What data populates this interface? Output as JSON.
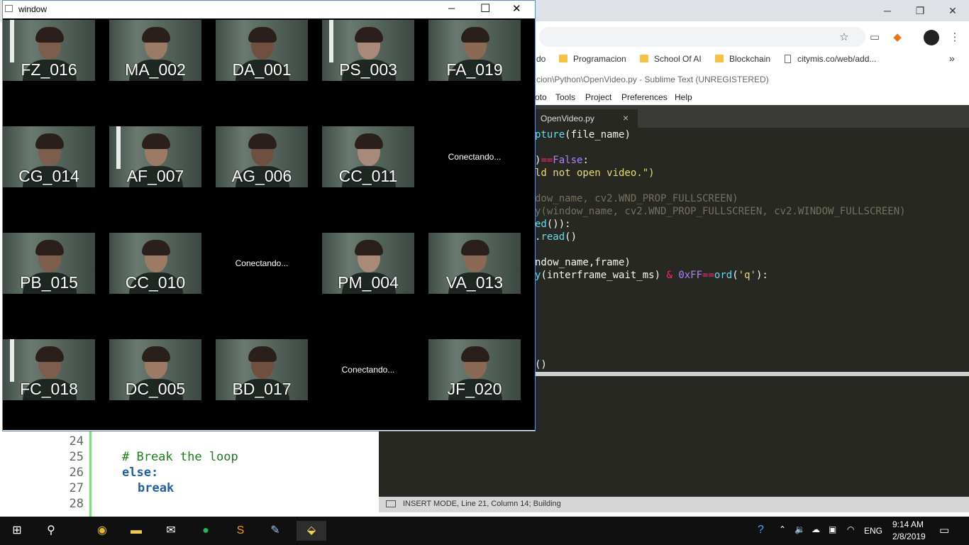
{
  "chrome": {
    "bookmarks": [
      {
        "label": "do",
        "type": "text"
      },
      {
        "label": "Programacion",
        "type": "folder"
      },
      {
        "label": "School Of AI",
        "type": "folder"
      },
      {
        "label": "Blockchain",
        "type": "folder"
      },
      {
        "label": "citymis.co/web/add...",
        "type": "page"
      }
    ],
    "more": "»",
    "controls": {
      "minimize": "─",
      "restore": "❐",
      "close": "✕"
    }
  },
  "sublime": {
    "title": "cion\\Python\\OpenVideo.py - Sublime Text (UNREGISTERED)",
    "menu": [
      "oto",
      "Tools",
      "Project",
      "Preferences",
      "Help"
    ],
    "tab": {
      "label": "OpenVideo.py",
      "close": "×"
    },
    "status": "INSERT MODE, Line 21, Column 14; Building"
  },
  "code_bg": {
    "lines": [
      {
        "num": "24",
        "text": ""
      },
      {
        "num": "25",
        "text": "# Break the loop"
      },
      {
        "num": "26",
        "text": "else:"
      },
      {
        "num": "27",
        "text": "break"
      },
      {
        "num": "28",
        "text": ""
      }
    ]
  },
  "video_window": {
    "title": "window",
    "controls": {
      "minimize": "─",
      "maximize": "☐",
      "close": "✕"
    },
    "cells": [
      {
        "label": "FZ_016"
      },
      {
        "label": "MA_002"
      },
      {
        "label": "DA_001"
      },
      {
        "label": "PS_003"
      },
      {
        "label": "FA_019"
      },
      {
        "label": "CG_014"
      },
      {
        "label": "AF_007"
      },
      {
        "label": "AG_006"
      },
      {
        "label": "CC_011"
      },
      {
        "status": "Conectando..."
      },
      {
        "label": "PB_015"
      },
      {
        "label": "CC_010"
      },
      {
        "status": "Conectando..."
      },
      {
        "label": "PM_004"
      },
      {
        "label": "VA_013"
      },
      {
        "label": "FC_018"
      },
      {
        "label": "DC_005"
      },
      {
        "label": "BD_017"
      },
      {
        "status": "Conectando..."
      },
      {
        "label": "JF_020"
      }
    ]
  },
  "taskbar": {
    "clock_time": "9:14 AM",
    "clock_date": "2/8/2019",
    "lang": "ENG"
  }
}
